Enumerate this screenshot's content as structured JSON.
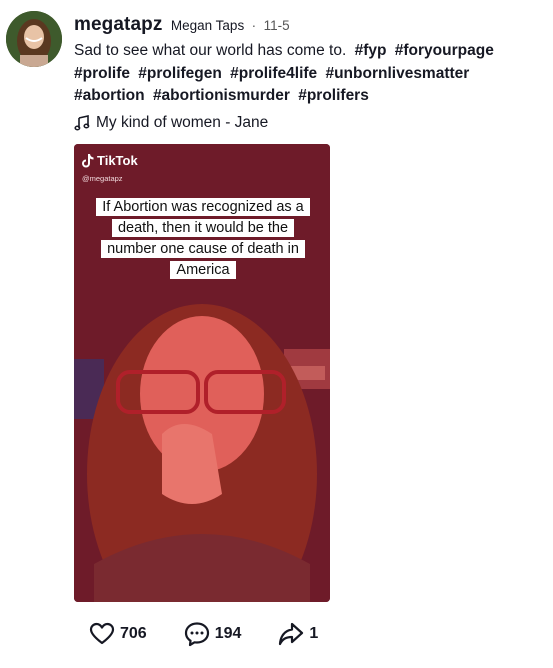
{
  "post": {
    "username": "megatapz",
    "nickname": "Megan Taps",
    "separator": "·",
    "date": "11-5",
    "caption_text": "Sad to see what our world has come to.",
    "hashtags": [
      "#fyp",
      "#foryourpage",
      "#prolife",
      "#prolifegen",
      "#prolife4life",
      "#unbornlivesmatter",
      "#abortion",
      "#abortionismurder",
      "#prolifers"
    ],
    "music": "My kind of women - Jane"
  },
  "video": {
    "watermark_brand": "TikTok",
    "watermark_handle": "@megatapz",
    "overlay_text": "If Abortion was recognized as a death, then it would be the number one cause of death in America"
  },
  "stats": {
    "likes": "706",
    "comments": "194",
    "shares": "1"
  },
  "icons": {
    "like": "heart-icon",
    "comment": "comment-bubble-icon",
    "share": "share-arrow-icon",
    "music": "music-note-icon"
  },
  "colors": {
    "text": "#161823",
    "video_tint": "#7a1d2c"
  }
}
